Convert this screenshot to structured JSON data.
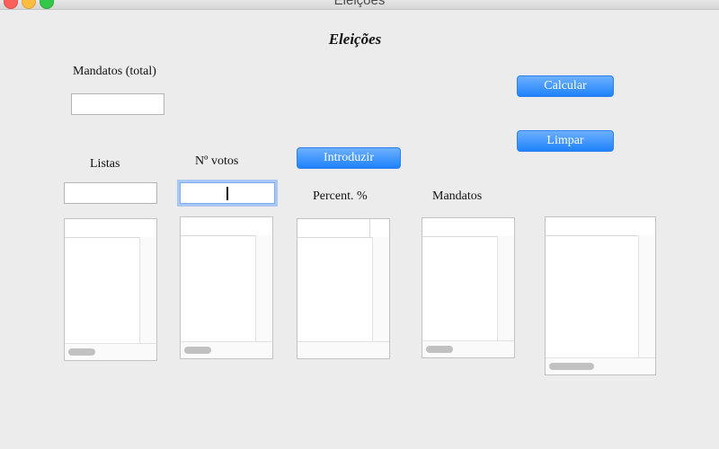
{
  "window": {
    "title": "Eleições"
  },
  "heading": "Eleições",
  "labels": {
    "mandatos_total": "Mandatos (total)",
    "listas": "Listas",
    "n_votos": "Nº votos",
    "percent": "Percent. %",
    "mandatos": "Mandatos"
  },
  "inputs": {
    "mandatos_total": {
      "value": ""
    },
    "listas": {
      "value": ""
    },
    "n_votos": {
      "value": ""
    }
  },
  "buttons": {
    "introduzir": "Introduzir",
    "calcular": "Calcular",
    "limpar": "Limpar"
  },
  "colors": {
    "button_accent": "#1f82fb",
    "focus_ring": "#a9c8f6",
    "window_bg": "#ececec"
  }
}
